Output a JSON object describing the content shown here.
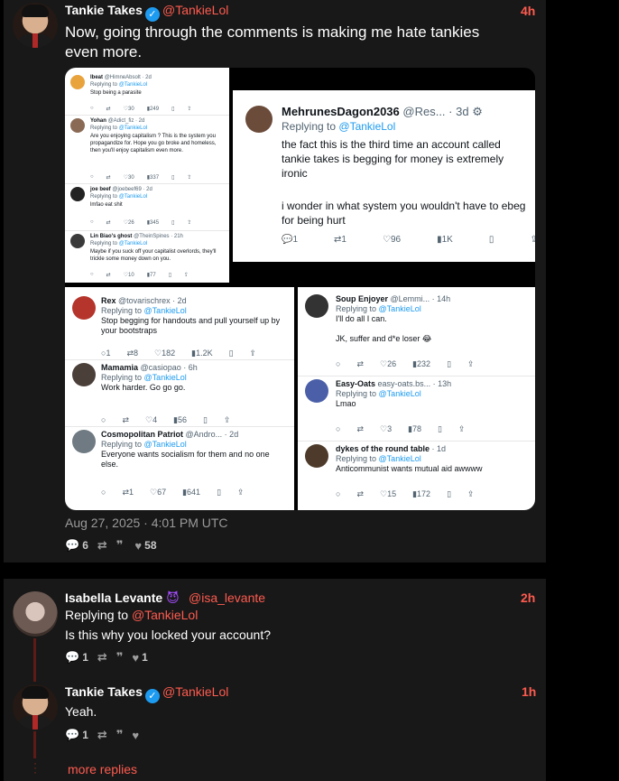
{
  "post": {
    "author_name": "Tankie Takes",
    "author_handle": "@TankieLol",
    "time": "4h",
    "text": "Now, going through the comments is making me hate tankies even more.",
    "timestamp": "Aug 27, 2025 · 4:01 PM UTC",
    "stats": {
      "comments": "6",
      "quotes": "",
      "likes": "58"
    }
  },
  "gallery": {
    "img1": [
      {
        "name": "Ibeat",
        "handle": "@HimneAbsolt · 2d",
        "replying": "Replying to",
        "target": "@TankieLol",
        "body": "Stop being a parasite",
        "acts": [
          "",
          "",
          "30",
          "249"
        ]
      },
      {
        "name": "Yohan",
        "handle": "@Adict_fiz · 2d",
        "replying": "Replying to",
        "target": "@TankieLol",
        "body": "Are you enjoying capitalism ? This is the system you propagandize for. Hope you go broke and homeless, then you'll enjoy capitalism even more.",
        "acts": [
          "",
          "",
          "30",
          "337"
        ]
      },
      {
        "name": "joe beef",
        "handle": "@joebeef69 · 2d",
        "replying": "Replying to",
        "target": "@TankieLol",
        "body": "lmfao eat shit",
        "acts": [
          "",
          "",
          "26",
          "345"
        ]
      },
      {
        "name": "Lin Biao's ghost",
        "handle": "@TheinSpines · 21h",
        "replying": "Replying to",
        "target": "@TankieLol",
        "body": "Maybe if you suck off your capitalist overlords, they'll trickle some money down on you.",
        "acts": [
          "",
          "",
          "10",
          "77"
        ]
      }
    ],
    "img2": {
      "name": "MehrunesDagon2036",
      "handle": "@Res... · 3d",
      "replying": "Replying to",
      "target": "@TankieLol",
      "body1": "the fact this is the third time an account called tankie takes is begging for money is extremely ironic",
      "body2": "i wonder in what system you wouldn't have to ebeg for being hurt",
      "acts": [
        "1",
        "1",
        "96",
        "1K"
      ]
    },
    "img3": [
      {
        "name": "Rex",
        "handle": "@tovarischrex · 2d",
        "replying": "Replying to",
        "target": "@TankieLol",
        "body": "Stop begging for handouts and pull yourself up by your bootstraps",
        "acts": [
          "1",
          "8",
          "182",
          "1.2K"
        ]
      },
      {
        "name": "Mamamia",
        "handle": "@casiopao · 6h",
        "replying": "Replying to",
        "target": "@TankieLol",
        "body": "Work harder. Go go go.",
        "acts": [
          "",
          "",
          "4",
          "56"
        ]
      },
      {
        "name": "Cosmopolitan Patriot",
        "handle": "@Andro... · 2d",
        "replying": "Replying to",
        "target": "@TankieLol",
        "body": "Everyone wants socialism for them and no one else.",
        "acts": [
          "",
          "1",
          "67",
          "641"
        ]
      }
    ],
    "img4": [
      {
        "name": "Soup Enjoyer",
        "handle": "@Lemmi... · 14h",
        "replying": "Replying to",
        "target": "@TankieLol",
        "body": "I'll do all I can.",
        "body2": "JK, suffer and d*e loser 😂",
        "acts": [
          "",
          "",
          "26",
          "232"
        ]
      },
      {
        "name": "Easy-Oats",
        "handle": "easy-oats.bs... · 13h",
        "replying": "Replying to",
        "target": "@TankieLol",
        "body": "Lmao",
        "acts": [
          "",
          "",
          "3",
          "78"
        ]
      },
      {
        "name": "dykes of the round table",
        "handle": "· 1d",
        "replying": "Replying to",
        "target": "@TankieLol",
        "body": "Anticommunist wants mutual aid awwww",
        "acts": [
          "",
          "",
          "15",
          "172"
        ]
      }
    ]
  },
  "reply1": {
    "author_name": "Isabella Levante",
    "author_handle": "@isa_levante",
    "time": "2h",
    "replying_prefix": "Replying to",
    "replying_target": "@TankieLol",
    "text": "Is this why you locked your account?",
    "stats": {
      "comments": "1",
      "likes": "1"
    }
  },
  "reply2": {
    "author_name": "Tankie Takes",
    "author_handle": "@TankieLol",
    "time": "1h",
    "text": "Yeah.",
    "stats": {
      "comments": "1"
    }
  },
  "more_replies": "more replies"
}
